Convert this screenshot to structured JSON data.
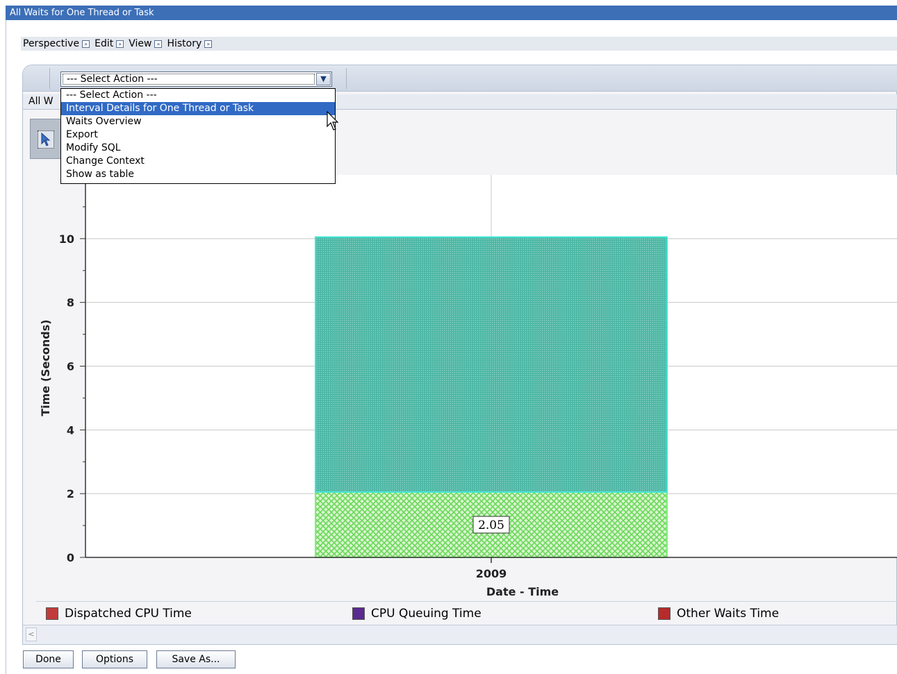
{
  "window": {
    "title": "All Waits for One Thread or Task"
  },
  "menubar": {
    "items": [
      {
        "label": "Perspective",
        "icon": "double-arrow-right-icon"
      },
      {
        "label": "Edit",
        "icon": "double-arrow-right-icon"
      },
      {
        "label": "View",
        "icon": "double-arrow-right-icon"
      },
      {
        "label": "History",
        "icon": "double-arrow-right-icon"
      }
    ]
  },
  "action_select": {
    "value": "--- Select Action ---",
    "options": [
      "--- Select Action ---",
      "Interval Details for One Thread or Task",
      "Waits Overview",
      "Export",
      "Modify SQL",
      "Change Context",
      "Show as table"
    ],
    "highlighted_index": 1
  },
  "tab": {
    "label": "All W"
  },
  "chart_data": {
    "type": "bar",
    "stacked": true,
    "categories": [
      "2009"
    ],
    "series": [
      {
        "name": "Dispatched CPU Time",
        "values": [
          2.05
        ],
        "color": "#7de36a"
      },
      {
        "name": "Other Waits Time",
        "values": [
          8.0
        ],
        "color": "#3fae98"
      }
    ],
    "data_labels": [
      "2.05"
    ],
    "xlabel": "Date - Time",
    "ylabel": "Time (Seconds)",
    "ylim": [
      0,
      12
    ],
    "yticks": [
      0,
      2,
      4,
      6,
      8,
      10
    ],
    "grid": true
  },
  "legend": {
    "items": [
      {
        "label": "Dispatched CPU Time",
        "color": "#c23b3b",
        "icon": "dispatched-cpu-legend-icon"
      },
      {
        "label": "CPU Queuing Time",
        "color": "#5b2a8f",
        "icon": "cpu-queuing-legend-icon"
      },
      {
        "label": "Other Waits Time",
        "color": "#b72b2b",
        "icon": "other-waits-legend-icon"
      }
    ]
  },
  "buttons": {
    "done": "Done",
    "options": "Options",
    "save_as": "Save As..."
  }
}
